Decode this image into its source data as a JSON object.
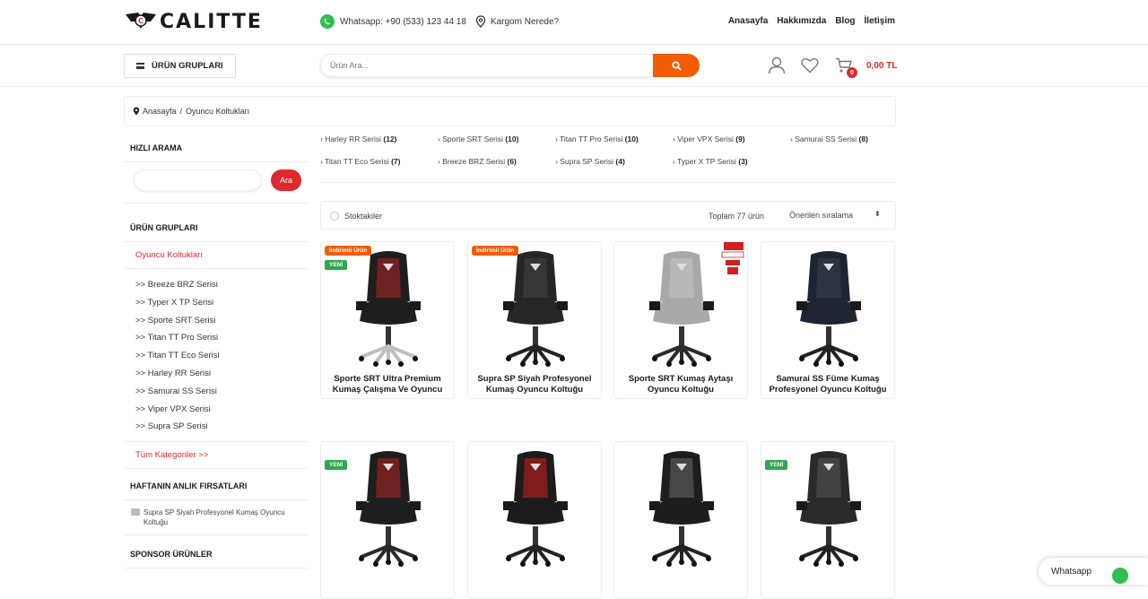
{
  "brand": {
    "name": "CALITTE",
    "accent": "#e0292d",
    "orange": "#f25c05",
    "green": "#2fa84f"
  },
  "header": {
    "whatsapp": "Whatsapp: +90 (533) 123 44 18",
    "cargo": "Kargom Nerede?",
    "nav": [
      "Anasayfa",
      "Hakkımızda",
      "Blog",
      "İletişim"
    ]
  },
  "toolbar": {
    "groups_button": "ÜRÜN GRUPLARI",
    "search_placeholder": "Ürün Ara...",
    "cart_count": "0",
    "cart_total": "0,00 TL"
  },
  "breadcrumb": {
    "home": "Anasayfa",
    "sep": "/",
    "current": "Oyuncu Koltukları"
  },
  "sidebar": {
    "quick_search_title": "HIZLI ARAMA",
    "quick_search_button": "Ara",
    "groups_title": "ÜRÜN GRUPLARI",
    "active_category": "Oyuncu Koltukları",
    "series": [
      ">> Breeze BRZ Serisi",
      ">> Typer X TP Serisi",
      ">> Sporte SRT Serisi",
      ">> Titan TT Pro Serisi",
      ">> Titan TT Eco Serisi",
      ">> Harley RR Serisi",
      ">> Samurai SS Serisi",
      ">> Viper VPX Serisi",
      ">> Supra SP Serisi"
    ],
    "all_categories": "Tüm Kategoriler  >>",
    "deals_title": "HAFTANIN ANLIK FIRSATLARI",
    "deal_item": "Supra SP Siyah Profesyonel Kumaş Oyuncu Koltuğu",
    "sponsor_title": "SPONSOR ÜRÜNLER"
  },
  "series_tags": [
    {
      "name": "› Harley RR Serisi",
      "count": "(12)"
    },
    {
      "name": "› Sporte SRT Serisi",
      "count": "(10)"
    },
    {
      "name": "› Titan TT Pro Serisi",
      "count": "(10)"
    },
    {
      "name": "› Viper VPX Serisi",
      "count": "(9)"
    },
    {
      "name": "› Samurai SS Serisi",
      "count": "(8)"
    },
    {
      "name": "› Titan TT Eco Serisi",
      "count": "(7)"
    },
    {
      "name": "› Breeze BRZ Serisi",
      "count": "(6)"
    },
    {
      "name": "› Supra SP Serisi",
      "count": "(4)"
    },
    {
      "name": "› Typer X TP Serisi",
      "count": "(3)"
    }
  ],
  "filter": {
    "stock_label": "Stoktakiler",
    "total": "Toplam 77 ürün",
    "sort": "Önerilen sıralama",
    "sort_arrows": "⬍"
  },
  "badges": {
    "sale": "İndirimli Ürün",
    "new": "YENİ",
    "fabric": "KUMAŞ"
  },
  "products": [
    {
      "name": "Sporte SRT Ultra Premium Kumaş Çalışma Ve Oyuncu",
      "color": "black-red"
    },
    {
      "name": "Supra SP Siyah Profesyonel Kumaş Oyuncu Koltuğu",
      "color": "black"
    },
    {
      "name": "Sporte SRT Kumaş Aytaşı Oyuncu Koltuğu",
      "color": "grey"
    },
    {
      "name": "Samurai SS Füme Kumaş Profesyonel Oyuncu Koltuğu",
      "color": "navy"
    },
    {
      "name": "",
      "color": "black-red"
    },
    {
      "name": "",
      "color": "red"
    },
    {
      "name": "",
      "color": "black-grey"
    },
    {
      "name": "",
      "color": "grey-dark"
    }
  ],
  "whatsapp_float": {
    "label": "Whatsapp"
  }
}
